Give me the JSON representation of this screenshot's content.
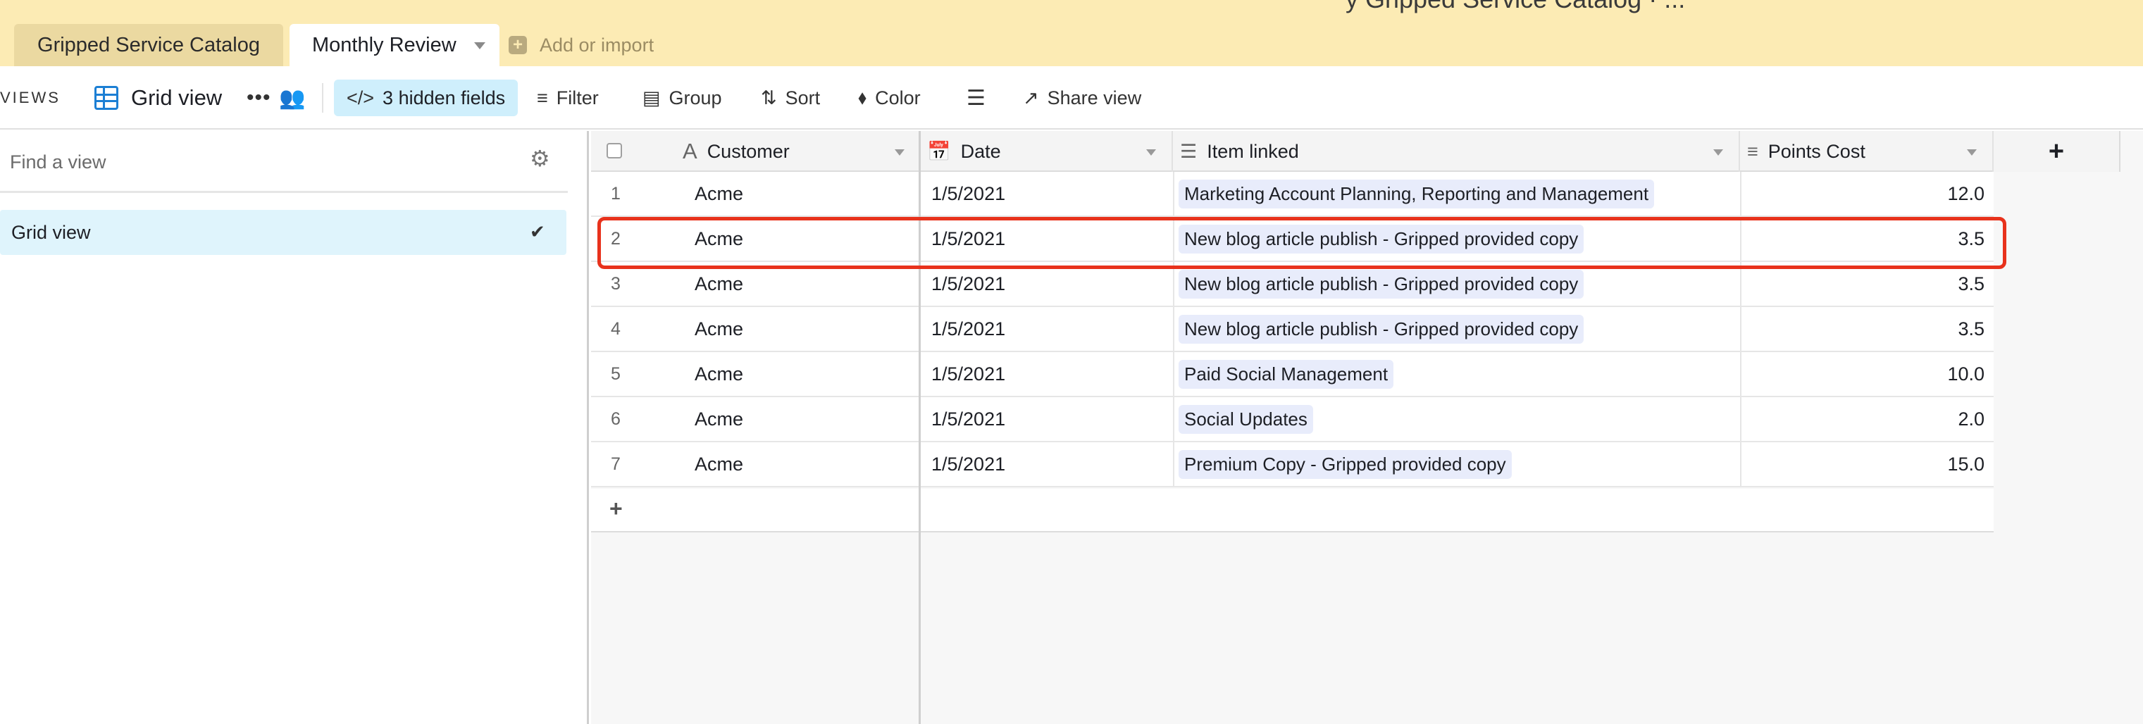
{
  "tabs": [
    {
      "label": "Gripped Service Catalog",
      "active": false
    },
    {
      "label": "Monthly Review",
      "active": true
    }
  ],
  "add_import_label": "Add or import",
  "base_title_cutoff": "y Gripped Service Catalog · ...",
  "toolbar": {
    "views_label": "VIEWS",
    "current_view": "Grid view",
    "more_icon": "ellipsis-icon",
    "hidden_fields": "3 hidden fields",
    "filter": "Filter",
    "group": "Group",
    "sort": "Sort",
    "color": "Color",
    "share_view": "Share view"
  },
  "sidebar": {
    "find_placeholder": "Find a view",
    "views": [
      {
        "label": "Grid view",
        "selected": true
      }
    ]
  },
  "grid": {
    "columns": [
      "Customer",
      "Date",
      "Item linked",
      "Points Cost"
    ],
    "add_column": "+",
    "rows": [
      {
        "num": "1",
        "customer": "Acme",
        "date": "1/5/2021",
        "item": "Marketing Account Planning, Reporting and Management",
        "points": "12.0"
      },
      {
        "num": "2",
        "customer": "Acme",
        "date": "1/5/2021",
        "item": "New blog article publish - Gripped provided copy",
        "points": "3.5"
      },
      {
        "num": "3",
        "customer": "Acme",
        "date": "1/5/2021",
        "item": "New blog article publish - Gripped provided copy",
        "points": "3.5"
      },
      {
        "num": "4",
        "customer": "Acme",
        "date": "1/5/2021",
        "item": "New blog article publish - Gripped provided copy",
        "points": "3.5"
      },
      {
        "num": "5",
        "customer": "Acme",
        "date": "1/5/2021",
        "item": "Paid Social Management",
        "points": "10.0"
      },
      {
        "num": "6",
        "customer": "Acme",
        "date": "1/5/2021",
        "item": "Social Updates",
        "points": "2.0"
      },
      {
        "num": "7",
        "customer": "Acme",
        "date": "1/5/2021",
        "item": "Premium Copy - Gripped provided copy",
        "points": "15.0"
      }
    ],
    "add_row": "+"
  },
  "colors": {
    "tabbar_bg": "#fcebb4",
    "accent_blue": "#1c7fd4",
    "selected_view_bg": "#dff4fc",
    "chip_bg": "#e8ecfb",
    "highlight_red": "#e8321c"
  }
}
